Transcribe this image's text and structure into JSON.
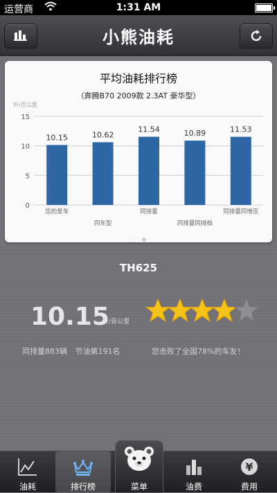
{
  "status_bar": {
    "carrier": "运营商",
    "time": "1:31 AM",
    "battery_level": 1.0
  },
  "navbar": {
    "title": "小熊油耗",
    "left_icon": "bar-chart-icon",
    "right_icon": "refresh-icon"
  },
  "chart_card": {
    "title": "平均油耗排行榜",
    "subtitle": "（奔腾B70 2009款 2.3AT 豪华型）",
    "page_dots": 2,
    "active_dot": 0
  },
  "chart_data": {
    "type": "bar",
    "ylabel": "升/百公里",
    "ylim": [
      0,
      15
    ],
    "yticks": [
      0,
      5,
      10,
      15
    ],
    "categories": [
      "您的爱车",
      "同车型",
      "同排量",
      "同排量同排档",
      "同排量同增压"
    ],
    "values": [
      10.15,
      10.62,
      11.54,
      10.89,
      11.53
    ],
    "value_labels": [
      "10.15",
      "10.62",
      "11.54",
      "10.89",
      "11.53"
    ],
    "bar_color": "#2f67a6",
    "grid": true
  },
  "summary": {
    "model": "TH625",
    "consumption": "10.15",
    "unit": "升/百公里",
    "rating": 4,
    "rating_max": 5,
    "rank_text": "同排量883辆  节油第191名",
    "beat_text": "您击败了全国78%的车友！"
  },
  "tabbar": {
    "tabs": [
      {
        "label": "油耗",
        "icon": "line-chart-icon",
        "active": false
      },
      {
        "label": "排行榜",
        "icon": "crown-icon",
        "active": true
      },
      {
        "label": "菜单",
        "icon": "bear-icon",
        "active": false
      },
      {
        "label": "油费",
        "icon": "bars-icon",
        "active": false
      },
      {
        "label": "费用",
        "icon": "yen-icon",
        "active": false
      }
    ]
  }
}
